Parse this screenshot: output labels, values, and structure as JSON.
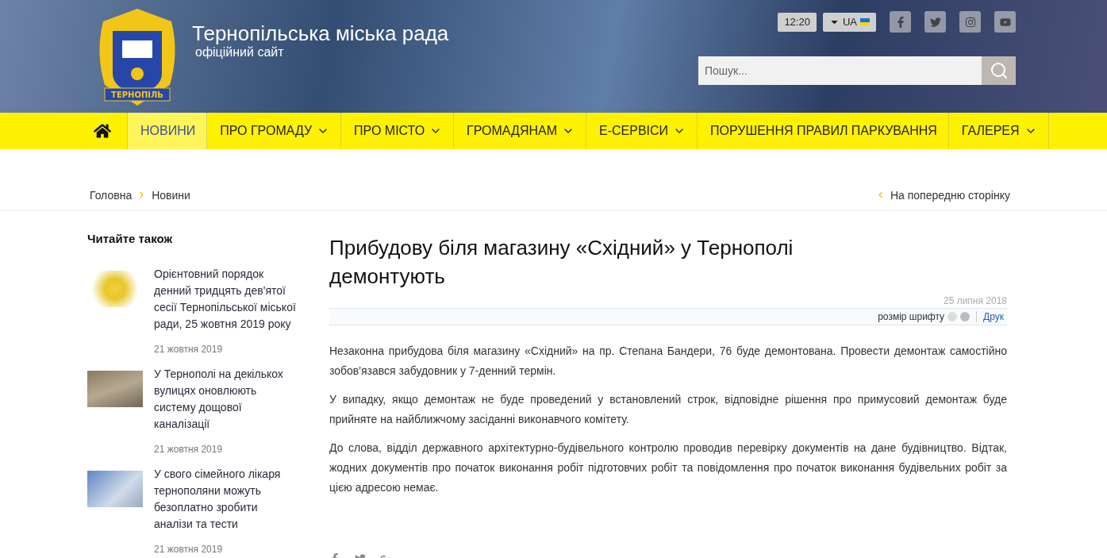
{
  "header": {
    "logo_text": "ТЕРНОПІЛЬ",
    "title": "Тернопільська міська рада",
    "subtitle": "офіційний сайт",
    "time": "12:20",
    "language": "UA",
    "search": {
      "placeholder": "Пошук..."
    }
  },
  "nav": [
    {
      "kind": "text",
      "label": "НОВИНИ",
      "selected": true,
      "dropdown": false
    },
    {
      "kind": "text",
      "label": "ПРО ГРОМАДУ",
      "selected": false,
      "dropdown": true
    },
    {
      "kind": "text",
      "label": "ПРО МІСТО",
      "selected": false,
      "dropdown": true
    },
    {
      "kind": "text",
      "label": "ГРОМАДЯНАМ",
      "selected": false,
      "dropdown": true
    },
    {
      "kind": "text",
      "label": "Е-СЕРВІСИ",
      "selected": false,
      "dropdown": true
    },
    {
      "kind": "text",
      "label": "ПОРУШЕННЯ ПРАВИЛ ПАРКУВАННЯ",
      "selected": false,
      "dropdown": false
    },
    {
      "kind": "text",
      "label": "ГАЛЕРЕЯ",
      "selected": false,
      "dropdown": true
    }
  ],
  "breadcrumbs": [
    "Головна",
    "Новини"
  ],
  "back_link": "На попередню сторінку",
  "sidebar": {
    "title": "Читайте також",
    "items": [
      {
        "kind": "emblem",
        "title": "Орієнтовний порядок денний тридцять дев'ятої сесії Тернопільської міської ради, 25 жовтня 2019 року",
        "date": "21 жовтня 2019"
      },
      {
        "kind": "street",
        "title": "У Тернополі на декількох вулицях оновлюють систему дощової каналізації",
        "date": "21 жовтня 2019"
      },
      {
        "kind": "lab",
        "title": "У свого сімейного лікаря тернополяни можуть безоплатно зробити аналізи та тести",
        "date": "21 жовтня 2019"
      }
    ]
  },
  "article": {
    "title": "Прибудову біля магазину «Східний» у Тернополі демонтують",
    "date": "25 липня 2018",
    "font_size_label": "розмір шрифту",
    "print": "Друк",
    "paragraphs": [
      "Незаконна прибудова біля магазину «Східний» на пр. Степана Бандери, 76 буде демонтована. Провести демонтаж самостійно зобов'язався забудовник у 7-денний термін.",
      "У випадку, якщо демонтаж не буде проведений у встановлений строк, відповідне рішення про примусовий демонтаж буде прийняте на найближчому засіданні виконавчого комітету.",
      "До слова, відділ державного архітектурно-будівельного контролю проводив перевірку документів на дане будівництво. Відтак, жодних документів про початок виконання робіт підготовчих робіт та повідомлення про початок виконання будівельних робіт за цією адресою немає."
    ]
  }
}
